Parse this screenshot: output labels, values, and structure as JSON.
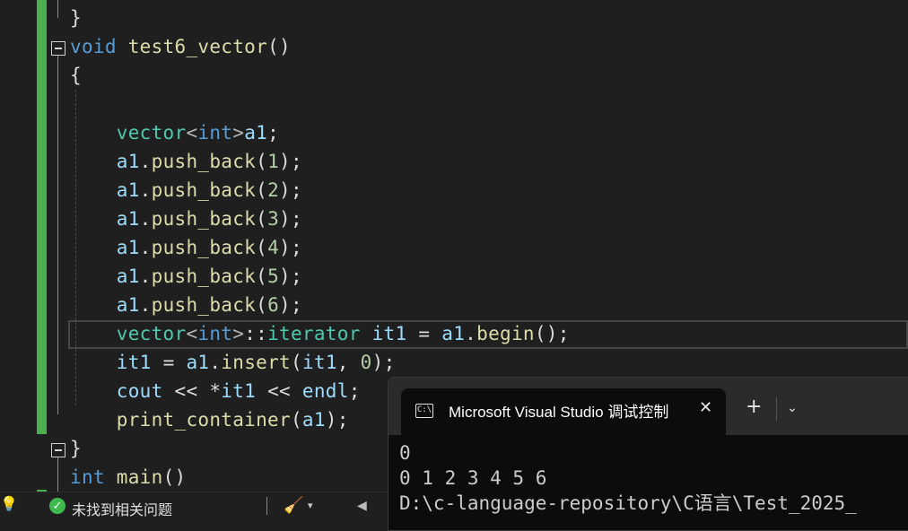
{
  "editor": {
    "lines": [
      {
        "tokens": [
          {
            "t": "}",
            "c": "pl"
          }
        ]
      },
      {
        "tokens": [
          {
            "t": "void",
            "c": "kw"
          },
          {
            "t": " ",
            "c": "pl"
          },
          {
            "t": "test6_vector",
            "c": "fn"
          },
          {
            "t": "()",
            "c": "pl"
          }
        ]
      },
      {
        "tokens": [
          {
            "t": "{",
            "c": "pl"
          }
        ]
      },
      {
        "tokens": []
      },
      {
        "tokens": [
          {
            "t": "    ",
            "c": "pl"
          },
          {
            "t": "vector",
            "c": "ty"
          },
          {
            "t": "<",
            "c": "op"
          },
          {
            "t": "int",
            "c": "kw"
          },
          {
            "t": ">",
            "c": "op"
          },
          {
            "t": "a1",
            "c": "var"
          },
          {
            "t": ";",
            "c": "pl"
          }
        ]
      },
      {
        "tokens": [
          {
            "t": "    ",
            "c": "pl"
          },
          {
            "t": "a1",
            "c": "var"
          },
          {
            "t": ".",
            "c": "pl"
          },
          {
            "t": "push_back",
            "c": "fn"
          },
          {
            "t": "(",
            "c": "pl"
          },
          {
            "t": "1",
            "c": "num"
          },
          {
            "t": ");",
            "c": "pl"
          }
        ]
      },
      {
        "tokens": [
          {
            "t": "    ",
            "c": "pl"
          },
          {
            "t": "a1",
            "c": "var"
          },
          {
            "t": ".",
            "c": "pl"
          },
          {
            "t": "push_back",
            "c": "fn"
          },
          {
            "t": "(",
            "c": "pl"
          },
          {
            "t": "2",
            "c": "num"
          },
          {
            "t": ");",
            "c": "pl"
          }
        ]
      },
      {
        "tokens": [
          {
            "t": "    ",
            "c": "pl"
          },
          {
            "t": "a1",
            "c": "var"
          },
          {
            "t": ".",
            "c": "pl"
          },
          {
            "t": "push_back",
            "c": "fn"
          },
          {
            "t": "(",
            "c": "pl"
          },
          {
            "t": "3",
            "c": "num"
          },
          {
            "t": ");",
            "c": "pl"
          }
        ]
      },
      {
        "tokens": [
          {
            "t": "    ",
            "c": "pl"
          },
          {
            "t": "a1",
            "c": "var"
          },
          {
            "t": ".",
            "c": "pl"
          },
          {
            "t": "push_back",
            "c": "fn"
          },
          {
            "t": "(",
            "c": "pl"
          },
          {
            "t": "4",
            "c": "num"
          },
          {
            "t": ");",
            "c": "pl"
          }
        ]
      },
      {
        "tokens": [
          {
            "t": "    ",
            "c": "pl"
          },
          {
            "t": "a1",
            "c": "var"
          },
          {
            "t": ".",
            "c": "pl"
          },
          {
            "t": "push_back",
            "c": "fn"
          },
          {
            "t": "(",
            "c": "pl"
          },
          {
            "t": "5",
            "c": "num"
          },
          {
            "t": ");",
            "c": "pl"
          }
        ]
      },
      {
        "tokens": [
          {
            "t": "    ",
            "c": "pl"
          },
          {
            "t": "a1",
            "c": "var"
          },
          {
            "t": ".",
            "c": "pl"
          },
          {
            "t": "push_back",
            "c": "fn"
          },
          {
            "t": "(",
            "c": "pl"
          },
          {
            "t": "6",
            "c": "num"
          },
          {
            "t": ");",
            "c": "pl"
          }
        ]
      },
      {
        "tokens": [
          {
            "t": "    ",
            "c": "pl"
          },
          {
            "t": "vector",
            "c": "ty"
          },
          {
            "t": "<",
            "c": "op"
          },
          {
            "t": "int",
            "c": "kw"
          },
          {
            "t": ">",
            "c": "op"
          },
          {
            "t": "::",
            "c": "pl"
          },
          {
            "t": "iterator",
            "c": "ty"
          },
          {
            "t": " ",
            "c": "pl"
          },
          {
            "t": "it1",
            "c": "var"
          },
          {
            "t": " = ",
            "c": "pl"
          },
          {
            "t": "a1",
            "c": "var"
          },
          {
            "t": ".",
            "c": "pl"
          },
          {
            "t": "begin",
            "c": "fn"
          },
          {
            "t": "();",
            "c": "pl"
          }
        ]
      },
      {
        "tokens": [
          {
            "t": "    ",
            "c": "pl"
          },
          {
            "t": "it1",
            "c": "var"
          },
          {
            "t": " = ",
            "c": "pl"
          },
          {
            "t": "a1",
            "c": "var"
          },
          {
            "t": ".",
            "c": "pl"
          },
          {
            "t": "insert",
            "c": "fn"
          },
          {
            "t": "(",
            "c": "pl"
          },
          {
            "t": "it1",
            "c": "var"
          },
          {
            "t": ", ",
            "c": "pl"
          },
          {
            "t": "0",
            "c": "num"
          },
          {
            "t": ");",
            "c": "pl"
          }
        ]
      },
      {
        "tokens": [
          {
            "t": "    ",
            "c": "pl"
          },
          {
            "t": "cout",
            "c": "var"
          },
          {
            "t": " << *",
            "c": "pl"
          },
          {
            "t": "it1",
            "c": "var"
          },
          {
            "t": " << ",
            "c": "pl"
          },
          {
            "t": "endl",
            "c": "var"
          },
          {
            "t": ";",
            "c": "pl"
          }
        ]
      },
      {
        "tokens": [
          {
            "t": "    ",
            "c": "pl"
          },
          {
            "t": "print_container",
            "c": "fn"
          },
          {
            "t": "(",
            "c": "pl"
          },
          {
            "t": "a1",
            "c": "var"
          },
          {
            "t": ");",
            "c": "pl"
          }
        ]
      },
      {
        "tokens": [
          {
            "t": "}",
            "c": "pl"
          }
        ]
      },
      {
        "tokens": [
          {
            "t": "int",
            "c": "kw"
          },
          {
            "t": " ",
            "c": "pl"
          },
          {
            "t": "main",
            "c": "fn"
          },
          {
            "t": "()",
            "c": "pl"
          }
        ]
      },
      {
        "tokens": [
          {
            "t": "{",
            "c": "pl"
          }
        ]
      }
    ]
  },
  "statusbar": {
    "issues_text": "未找到相关问题",
    "ok_icon": "check-circle-icon",
    "cleanup_icon": "brush-icon"
  },
  "terminal": {
    "tab_title": "Microsoft Visual Studio 调试控制台",
    "close_glyph": "✕",
    "new_tab_glyph": "+",
    "dropdown_glyph": "⌄",
    "output": [
      "0",
      "0 1 2 3 4 5 6",
      "D:\\c-language-repository\\C语言\\Test_2025_"
    ]
  }
}
